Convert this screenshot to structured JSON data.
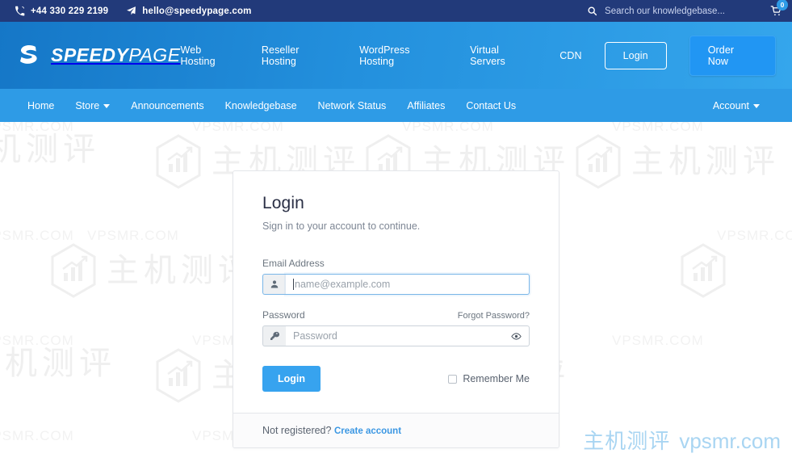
{
  "topbar": {
    "phone": "+44 330 229 2199",
    "email": "hello@speedypage.com",
    "search_placeholder": "Search our knowledgebase...",
    "cart_count": "0"
  },
  "header": {
    "brand_bold": "SPEEDY",
    "brand_light": "PAGE",
    "nav": [
      {
        "label": "Web Hosting"
      },
      {
        "label": "Reseller Hosting"
      },
      {
        "label": "WordPress Hosting"
      },
      {
        "label": "Virtual Servers"
      },
      {
        "label": "CDN"
      }
    ],
    "login_label": "Login",
    "order_label": "Order Now"
  },
  "subnav": {
    "items": [
      {
        "label": "Home",
        "caret": false
      },
      {
        "label": "Store",
        "caret": true
      },
      {
        "label": "Announcements",
        "caret": false
      },
      {
        "label": "Knowledgebase",
        "caret": false
      },
      {
        "label": "Network Status",
        "caret": false
      },
      {
        "label": "Affiliates",
        "caret": false
      },
      {
        "label": "Contact Us",
        "caret": false
      }
    ],
    "account_label": "Account"
  },
  "login_card": {
    "title": "Login",
    "subtitle": "Sign in to your account to continue.",
    "email_label": "Email Address",
    "email_placeholder": "name@example.com",
    "email_value": "",
    "password_label": "Password",
    "password_placeholder": "Password",
    "password_value": "",
    "forgot_label": "Forgot Password?",
    "submit_label": "Login",
    "remember_label": "Remember Me",
    "footer_text": "Not registered?",
    "footer_link": "Create account"
  },
  "watermark": {
    "cn": "主机测评",
    "en": "vpsmr.com",
    "bg_cn": "主机测评",
    "bg_en": "VPSMR.COM"
  },
  "colors": {
    "topbar_bg": "#223a7a",
    "header_start": "#1577c7",
    "header_end": "#35a6ec",
    "subnav_bg": "#2e9be6",
    "accent": "#37a3ef",
    "link": "#3b97e3",
    "watermark": "#a9d5f2"
  }
}
